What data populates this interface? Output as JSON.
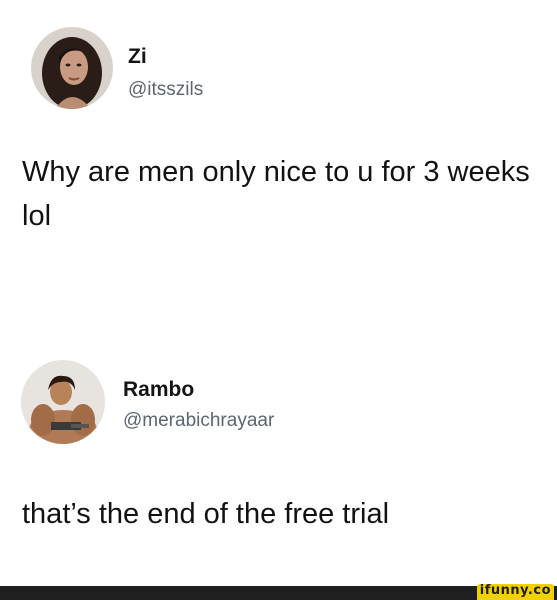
{
  "tweets": [
    {
      "display_name": "Zi",
      "handle": "@itsszils",
      "text": "Why are men only nice to u for 3 weeks lol"
    },
    {
      "display_name": "Rambo",
      "handle": "@merabichrayaar",
      "text": "that’s the end of the free trial"
    }
  ],
  "watermark": {
    "text": "ifunny.co",
    "bar_color": "#1f1f1f",
    "badge_color": "#f2d100"
  },
  "colors": {
    "text": "#121212",
    "handle": "#5b6670",
    "background": "#ffffff"
  }
}
